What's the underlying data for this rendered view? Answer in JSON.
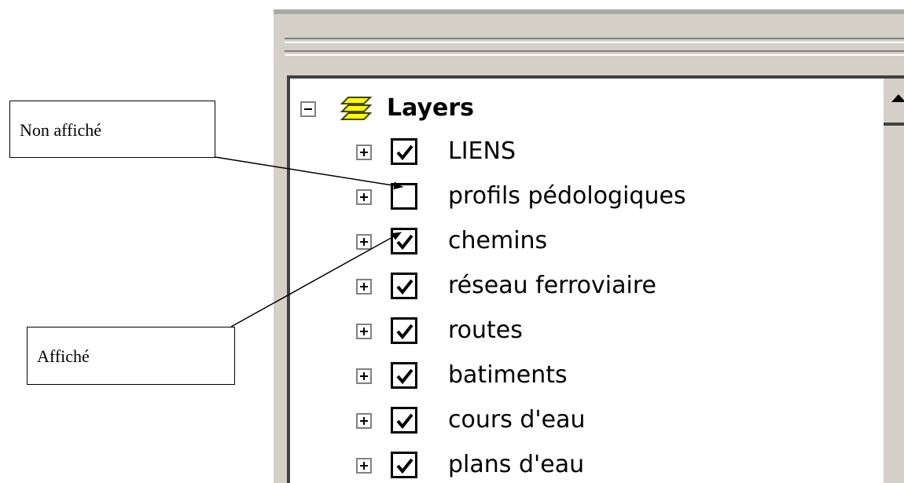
{
  "callouts": {
    "not_displayed": "Non affiché",
    "displayed": "Affiché"
  },
  "toc": {
    "root": {
      "label": "Layers",
      "expanded": true,
      "icon": "layers-stack-icon"
    },
    "layers": [
      {
        "label": "LIENS",
        "checked": true
      },
      {
        "label": "profils pédologiques",
        "checked": false
      },
      {
        "label": "chemins",
        "checked": true
      },
      {
        "label": "réseau ferroviaire",
        "checked": true
      },
      {
        "label": "routes",
        "checked": true
      },
      {
        "label": "batiments",
        "checked": true
      },
      {
        "label": "cours d'eau",
        "checked": true
      },
      {
        "label": "plans d'eau",
        "checked": true
      }
    ]
  },
  "colors": {
    "panel_face": "#d4d0c8",
    "tree_background": "#ffffff",
    "layers_icon_fill": "#ffff00"
  }
}
